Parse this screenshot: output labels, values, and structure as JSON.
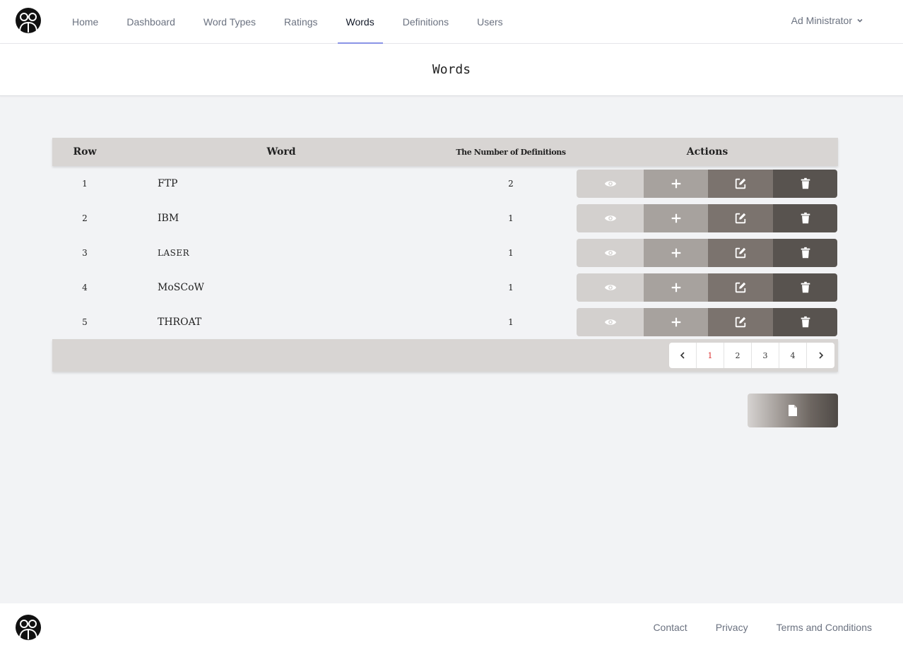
{
  "nav": {
    "items": [
      {
        "label": "Home"
      },
      {
        "label": "Dashboard"
      },
      {
        "label": "Word Types"
      },
      {
        "label": "Ratings"
      },
      {
        "label": "Words"
      },
      {
        "label": "Definitions"
      },
      {
        "label": "Users"
      }
    ],
    "active": "Words",
    "user": "Ad Ministrator"
  },
  "page": {
    "title": "Words"
  },
  "table": {
    "headers": {
      "row": "Row",
      "word": "Word",
      "num": "The Number of Definitions",
      "actions": "Actions"
    },
    "rows": [
      {
        "row": "1",
        "word": "FTP",
        "num": "2"
      },
      {
        "row": "2",
        "word": "IBM",
        "num": "1"
      },
      {
        "row": "3",
        "word": "LASER",
        "num": "1"
      },
      {
        "row": "4",
        "word": "MoSCoW",
        "num": "1"
      },
      {
        "row": "5",
        "word": "THROAT",
        "num": "1"
      }
    ],
    "actions_icons": [
      "eye-icon",
      "plus-icon",
      "edit-icon",
      "trash-icon"
    ]
  },
  "pagination": {
    "pages": [
      "1",
      "2",
      "3",
      "4"
    ],
    "current": "1"
  },
  "footer": {
    "links": [
      "Contact",
      "Privacy",
      "Terms and Conditions"
    ]
  },
  "colors": {
    "accent": "#8a94e6",
    "current_page": "#dd3333"
  }
}
